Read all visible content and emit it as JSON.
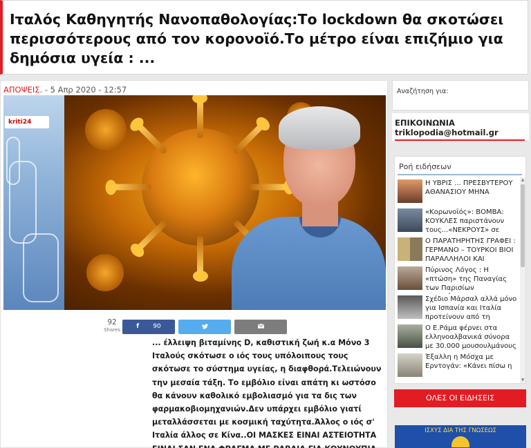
{
  "article": {
    "title": "Ιταλός Καθηγητής Νανοπαθολογίας:Το lockdown θα σκοτώσει περισσότερους από τον κορονοϊό.Το μέτρο είναι επιζήμιο για δημόσια υγεία : ...",
    "category": "ΑΠΟΨΕΙΣ.",
    "date": " - 5 Απρ 2020 - 12:57",
    "body": "... έλλειψη βιταμίνης D, καθιστική ζωή κ.α Μόνο 3 Ιταλούς σκότωσε ο ιός τους υπόλοιπους τους σκότωσε το σύστημα υγείας, η διαφθορά.Τελειώνουν την μεσαία τάξη. Το εμβόλιο είναι απάτη κι ωστόσο θα κάνουν καθολικό εμβολιασμό για τα δις των φαρμακοβιομηχανιών.Δεν υπάρχει εμβόλιο γιατί μεταλλάσσεται με κοσμική ταχύτητα.Άλλος ο ιός σ' Ιταλία άλλος σε Κίνα..ΟΙ ΜΑΣΚΕΣ ΕΙΝΑΙ ΑΣΤΕΙΟΤΗΤΑ ΕΙΝΑΙ ΣΑΝ ΕΝΑ ΦΡΑΓΜΑ ΜΕ ΡΑΒΔΙΑ ΓΙΑ ΚΟΥΝΟΥΠΙΑ"
  },
  "hero_logo": "kriti24",
  "share": {
    "total": "92",
    "total_label": "Shares",
    "facebook_icon": "f",
    "facebook_count": "90",
    "twitter_icon": "twitter-icon",
    "email_icon": "email-icon",
    "colors": {
      "facebook": "#3b5998",
      "twitter": "#55acee",
      "email": "#7d7d7d"
    }
  },
  "sidebar": {
    "search_label": "Αναζήτηση για:",
    "contact_title": "ΕΠΙΚΟΙΝΩΝΙΑ",
    "contact_email": "triklopodia@hotmail.gr",
    "feed_title": "Ροή ειδήσεων",
    "feed": [
      {
        "text": "Η ΥΒΡΙΣ ... ΠΡΕΣΒΥΤΕΡΟΥ ΑΘΑΝΑΣΙΟΥ ΜΗΝΑ"
      },
      {
        "text": "«Κορωνοϊός»: ΒΟΜΒΑ: ΚΟΥΚΛΕΣ παριστάνουν τους...«ΝΕΚΡΟΥΣ» σε"
      },
      {
        "text": "Ο ΠΑΡΑΤΗΡΗΤΗΣ ΓΡΑΦΕΙ : ΓΕΡΜΑΝΟ – ΤΟΥΡΚΟΙ ΒΙΟΙ ΠΑΡΑΛΛΗΛΟΙ ΚΑΙ"
      },
      {
        "text": "Πύρινος Λόγος : Η «πτώση» της Παναγίας των Παρισίων «προφήτευσε»"
      },
      {
        "text": "Σχέδιο Μάρσαλ αλλά μόνο για Ισπανία και Ιταλία προτείνουν από τη"
      },
      {
        "text": "Ο Ε.Ράμα φέρνει στα ελληνοαλβανικά σύνορα με 30.000 μουσουλμάνους"
      },
      {
        "text": "Έξαλλη η Μόσχα με Ερντογάν: «Κάνει πίσω η"
      }
    ],
    "all_news": "ΟΛΕΣ ΟΙ ΕΙΔΗΣΕΙΣ",
    "banner_text": "ΙΣΧΥΣ ΔΙΑ ΤΗΣ ΓΝΩΣΕΩΣ"
  },
  "colors": {
    "accent": "#e31c23"
  }
}
